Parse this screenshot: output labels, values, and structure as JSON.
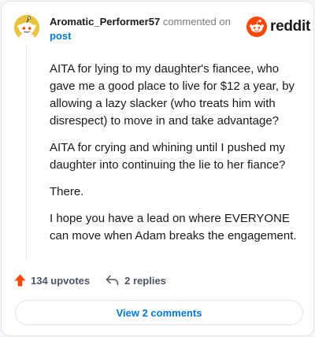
{
  "header": {
    "username": "Aromatic_Performer57",
    "action_text": "commented on",
    "target_link": "post"
  },
  "logo": {
    "word": "reddit",
    "icon": "reddit-snoo-icon",
    "brand_color": "#ff4500"
  },
  "comment": {
    "paragraphs": [
      "AITA for lying to my daughter's fiancee, who gave me a good place to live for $12 a year, by allowing a lazy slacker (who treats him with disrespect) to move in and take advantage?",
      "AITA for crying and whining until I pushed my daughter into continuing the lie to her fiance?",
      "There.",
      "I hope you have a lead on where EVERYONE can move when Adam breaks the engagement."
    ]
  },
  "actions": {
    "upvotes_label": "134 upvotes",
    "upvote_icon": "upvote-arrow-icon",
    "replies_label": "2 replies",
    "reply_icon": "reply-arrow-icon"
  },
  "footer": {
    "view_comments_label": "View 2 comments"
  },
  "colors": {
    "accent": "#0079d3",
    "upvote": "#ff4500",
    "avatar_bg": "#e8c33f"
  }
}
